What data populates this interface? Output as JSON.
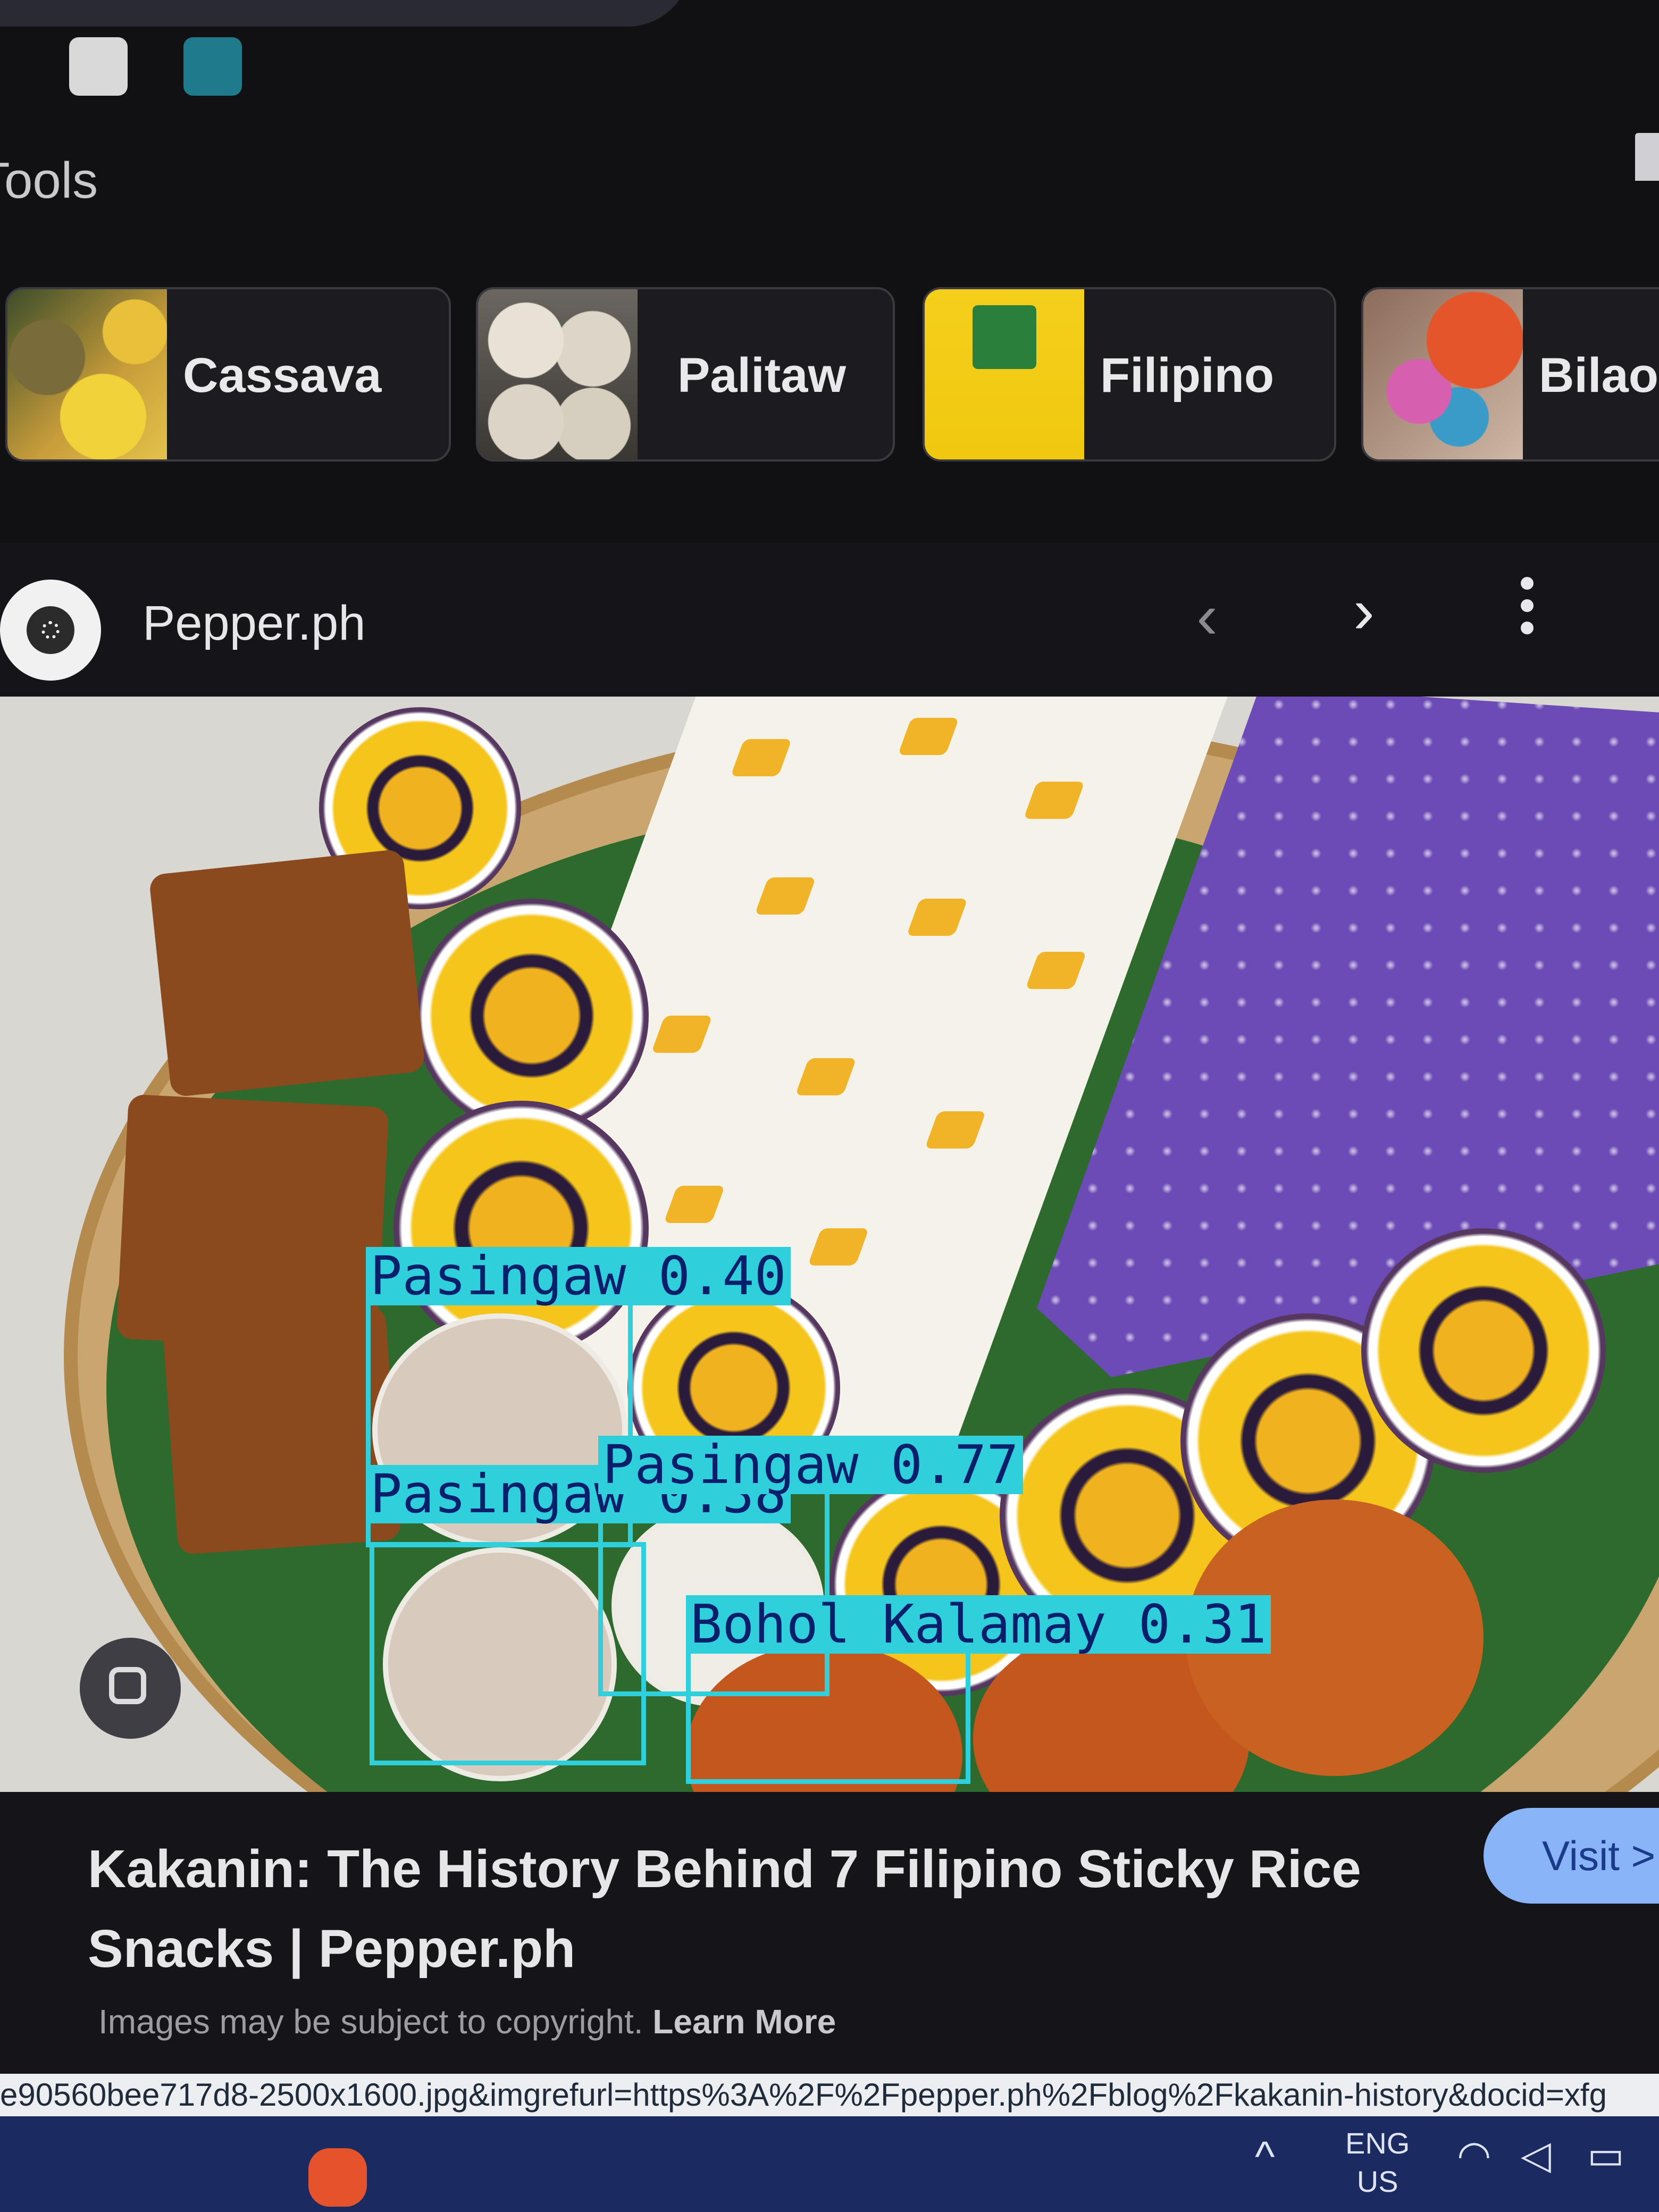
{
  "header": {
    "tools_label": "Tools"
  },
  "chips": [
    {
      "label": "Cassava"
    },
    {
      "label": "Palitaw"
    },
    {
      "label": "Filipino"
    },
    {
      "label": "Bilao"
    }
  ],
  "result": {
    "site_name": "Pepper.ph",
    "prev_icon": "‹",
    "next_icon": "›",
    "title_line1": "Kakanin: The History Behind 7 Filipino Sticky Rice",
    "title_line2": "Snacks | Pepper.ph",
    "visit_label": "Visit >",
    "copyright_text": "Images may be subject to copyright.",
    "learn_more": "Learn More"
  },
  "detections": [
    {
      "label": "Pasingaw 0.40"
    },
    {
      "label": "Pasingaw 0.77"
    },
    {
      "label": "Pasingaw 0.38"
    },
    {
      "label": "Bohol Kalamay 0.31"
    }
  ],
  "url_text": "e90560bee717d8-2500x1600.jpg&imgrefurl=https%3A%2F%2Fpepper.ph%2Fblog%2Fkakanin-history&docid=xfg",
  "taskbar": {
    "chevron": "^",
    "lang_line1": "ENG",
    "lang_line2": "US"
  },
  "colors": {
    "detection_box": "#2fd0dc",
    "detection_text": "#0a1f6b",
    "visit_button": "#8ab4f8",
    "taskbar": "#1c2a62"
  }
}
